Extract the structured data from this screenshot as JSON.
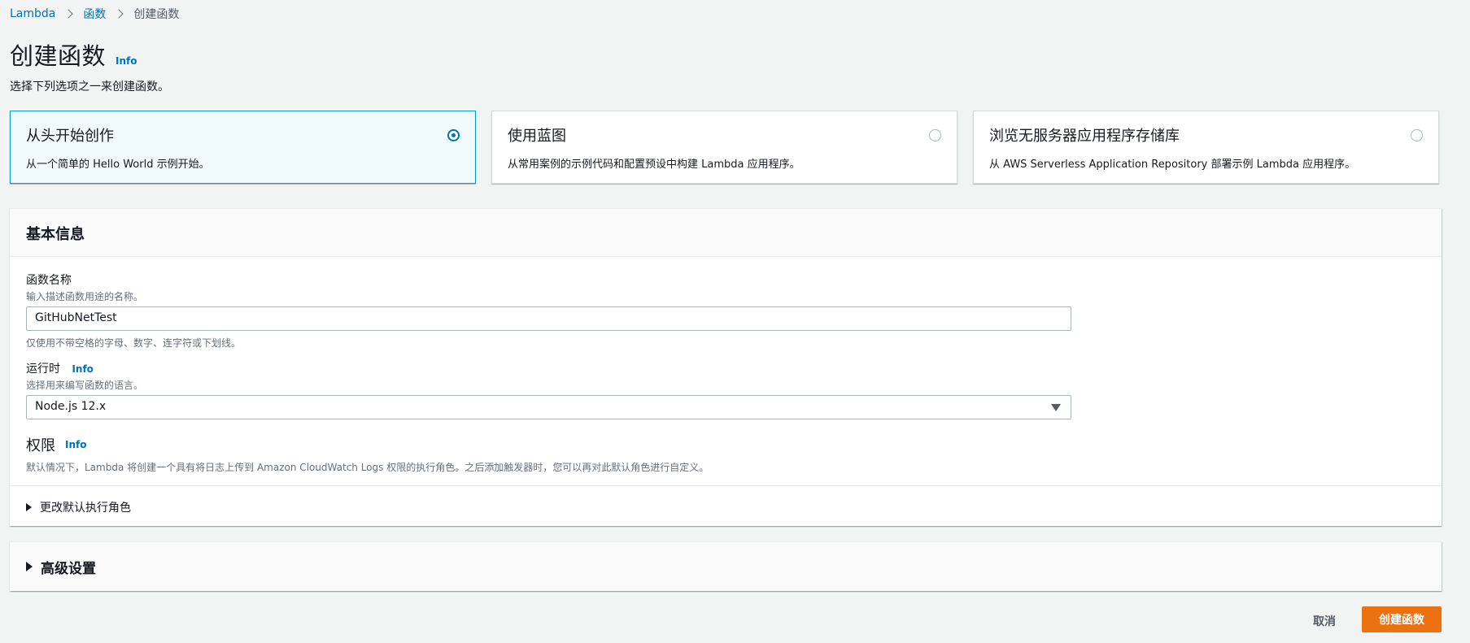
{
  "breadcrumb": {
    "items": [
      "Lambda",
      "函数",
      "创建函数"
    ]
  },
  "header": {
    "title": "创建函数",
    "info": "Info",
    "subtitle": "选择下列选项之一来创建函数。"
  },
  "options": [
    {
      "title": "从头开始创作",
      "desc": "从一个简单的 Hello World 示例开始。",
      "selected": true
    },
    {
      "title": "使用蓝图",
      "desc": "从常用案例的示例代码和配置预设中构建 Lambda 应用程序。",
      "selected": false
    },
    {
      "title": "浏览无服务器应用程序存储库",
      "desc": "从 AWS Serverless Application Repository 部署示例 Lambda 应用程序。",
      "selected": false
    }
  ],
  "basic": {
    "heading": "基本信息",
    "name_label": "函数名称",
    "name_desc": "输入描述函数用途的名称。",
    "name_value": "GitHubNetTest",
    "name_hint": "仅使用不带空格的字母、数字、连字符或下划线。",
    "runtime_label": "运行时",
    "runtime_info": "Info",
    "runtime_desc": "选择用来编写函数的语言。",
    "runtime_value": "Node.js 12.x",
    "perm_title": "权限",
    "perm_info": "Info",
    "perm_desc": "默认情况下，Lambda 将创建一个具有将日志上传到 Amazon CloudWatch Logs 权限的执行角色。之后添加触发器时，您可以再对此默认角色进行自定义。",
    "role_expander": "更改默认执行角色"
  },
  "advanced": {
    "label": "高级设置"
  },
  "footer": {
    "cancel": "取消",
    "create": "创建函数"
  },
  "colors": {
    "link": "#0073bb",
    "primary_button": "#ec7211",
    "selected_card_bg": "#f1faff",
    "selected_card_border": "#00a1c9"
  }
}
